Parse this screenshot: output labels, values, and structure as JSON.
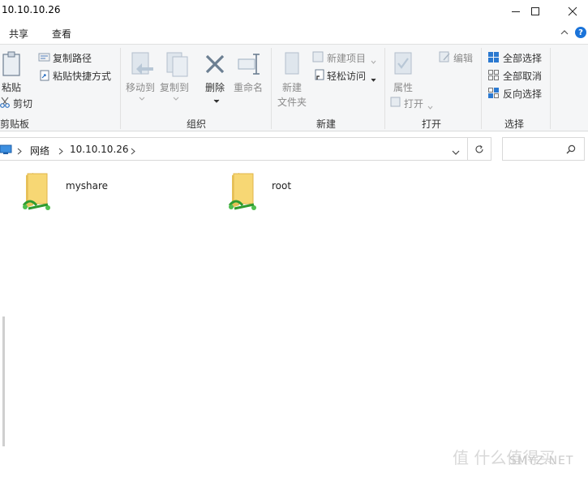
{
  "window": {
    "title": "10.10.10.26"
  },
  "ribbon_tabs": [
    "共享",
    "查看"
  ],
  "ribbon": {
    "clipboard": {
      "paste": "粘贴",
      "copy_path": "复制路径",
      "paste_shortcut": "粘贴快捷方式",
      "cut": "剪切",
      "group_label": "剪贴板"
    },
    "organize": {
      "move_to": "移动到",
      "copy_to": "复制到",
      "delete": "删除",
      "rename": "重命名",
      "group_label": "组织"
    },
    "new": {
      "new_folder_line1": "新建",
      "new_folder_line2": "文件夹",
      "new_item": "新建项目",
      "easy_access": "轻松访问",
      "group_label": "新建"
    },
    "open": {
      "properties": "属性",
      "open": "打开",
      "edit": "编辑",
      "group_label": "打开"
    },
    "select": {
      "select_all": "全部选择",
      "select_none": "全部取消",
      "invert_selection": "反向选择",
      "group_label": "选择"
    }
  },
  "address": {
    "crumbs": [
      "网络",
      "10.10.10.26"
    ]
  },
  "items": [
    {
      "name": "myshare"
    },
    {
      "name": "root"
    }
  ],
  "watermark": {
    "text": "值 什么值得买",
    "site": "SMYZ.NET"
  }
}
